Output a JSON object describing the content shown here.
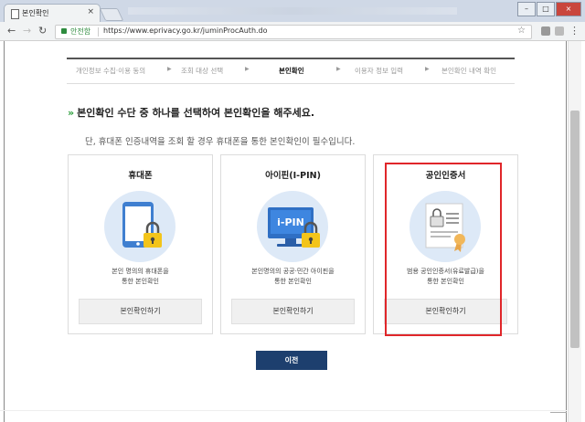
{
  "browser": {
    "tab_title": "본인확인",
    "secure_label": "안전함",
    "url": "https://www.eprivacy.go.kr/juminProcAuth.do"
  },
  "steps": [
    "개인정보 수집·이용 동의",
    "조회 대상 선택",
    "본인확인",
    "이용자 정보 입력",
    "본인확인 내역 확인"
  ],
  "active_step": 2,
  "heading": "본인확인 수단 중 하나를 선택하여 본인확인을 해주세요.",
  "subtext": "단, 휴대폰 인증내역을 조회 할 경우 휴대폰을 통한 본인확인이 필수입니다.",
  "cards": [
    {
      "title": "휴대폰",
      "desc1": "본인 명의의 휴대폰을",
      "desc2": "통한 본인확인",
      "button": "본인확인하기"
    },
    {
      "title": "아이핀(I-PIN)",
      "desc1": "본인명의의 공공·민간 아이핀을",
      "desc2": "통한 본인확인",
      "button": "본인확인하기",
      "icon_text": "i-PIN"
    },
    {
      "title": "공인인증서",
      "desc1": "범용 공인인증서(유료발급)을",
      "desc2": "통한 본인확인",
      "button": "본인확인하기"
    }
  ],
  "prev_button": "이전",
  "colors": {
    "accent_navy": "#1d3f6e",
    "highlight_red": "#e0262a",
    "chevron_green": "#2a9d3a"
  }
}
